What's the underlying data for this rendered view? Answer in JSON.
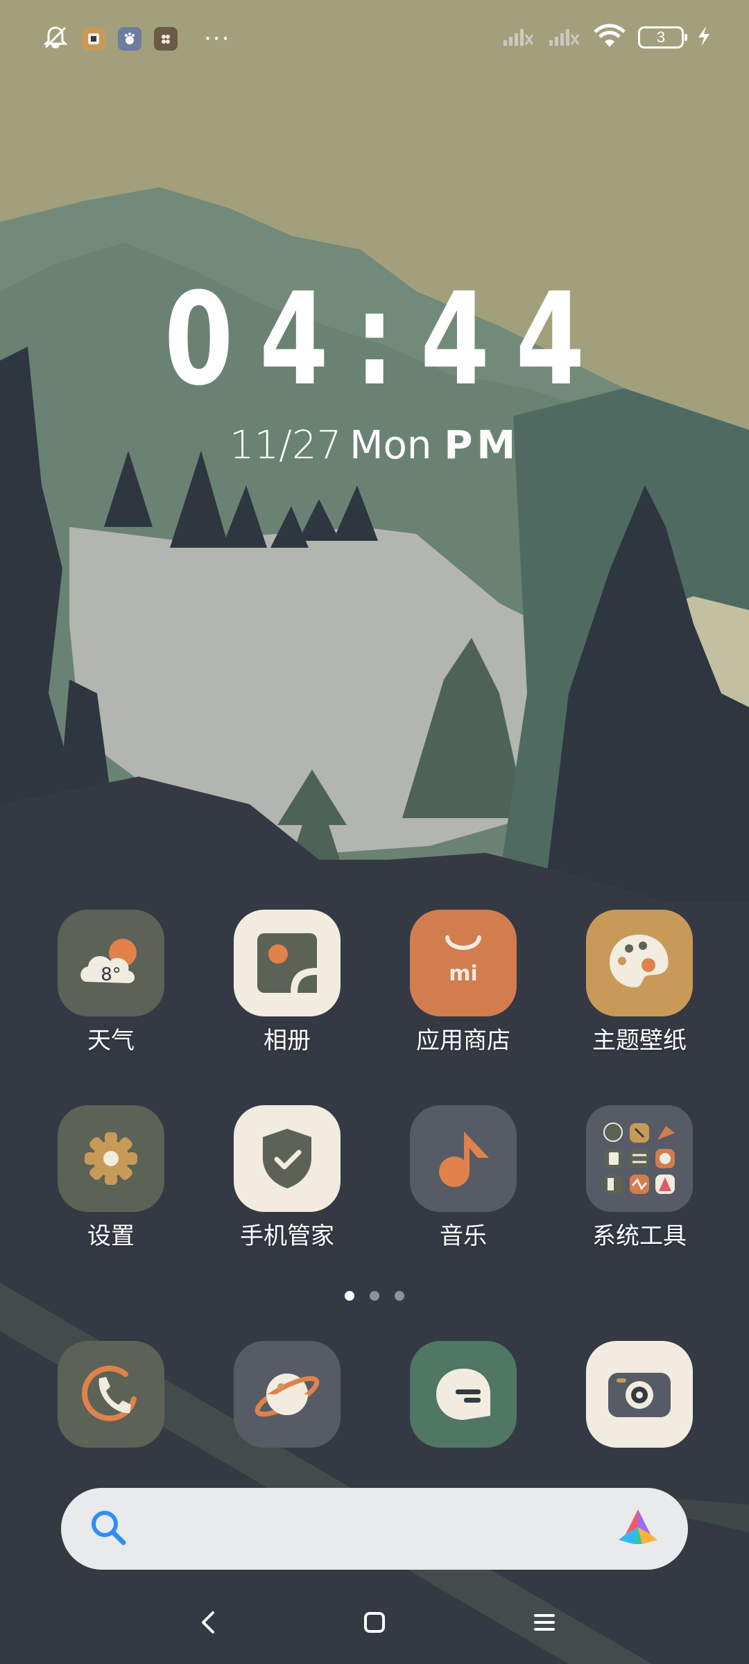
{
  "status_bar": {
    "icons": [
      "bell-muted-icon",
      "notification-app-icon-1",
      "notification-app-icon-2",
      "notification-app-icon-3",
      "more-dots-icon",
      "signal-1-icon",
      "signal-2-icon",
      "wifi-icon",
      "battery-icon",
      "charging-icon"
    ],
    "more": "···",
    "battery_level": "3"
  },
  "clock": {
    "time": "04:44",
    "month_day": "11/27",
    "weekday": "Mon",
    "ampm": "PM"
  },
  "apps": [
    {
      "label": "天气",
      "icon": "weather-icon",
      "weather_temp": "8°"
    },
    {
      "label": "相册",
      "icon": "gallery-icon"
    },
    {
      "label": "应用商店",
      "icon": "app-store-icon",
      "badge_text": "mi"
    },
    {
      "label": "主题壁纸",
      "icon": "theme-palette-icon"
    },
    {
      "label": "设置",
      "icon": "settings-gear-icon"
    },
    {
      "label": "手机管家",
      "icon": "security-shield-icon"
    },
    {
      "label": "音乐",
      "icon": "music-note-icon"
    },
    {
      "label": "系统工具",
      "icon": "system-tools-folder-icon"
    }
  ],
  "page_indicator": {
    "count": 3,
    "active_index": 0
  },
  "dock": [
    {
      "icon": "phone-icon"
    },
    {
      "icon": "browser-planet-icon"
    },
    {
      "icon": "messages-icon"
    },
    {
      "icon": "camera-icon"
    }
  ],
  "search": {
    "placeholder": "",
    "left_icon": "search-icon",
    "right_icon": "ai-assistant-icon"
  },
  "nav": {
    "back": "back-icon",
    "home": "home-icon",
    "recents": "recents-menu-icon"
  },
  "colors": {
    "sky": "#a2a07c",
    "mountain_far": "#728a7a",
    "mountain_mid": "#5d7569",
    "snow": "#b2b5b0",
    "dark_ground": "#343944",
    "tree_dark": "#2e3640",
    "accent_orange": "#e0824a",
    "icon_cream": "#f1ecdf",
    "icon_olive": "#5c6256",
    "icon_slate": "#575b66",
    "icon_green": "#4f7763",
    "icon_gold": "#c89a58"
  }
}
